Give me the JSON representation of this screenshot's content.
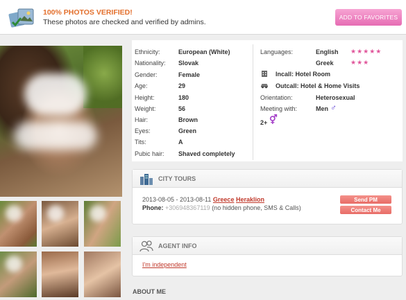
{
  "verified": {
    "title": "100% PHOTOS VERIFIED!",
    "subtitle": "These photos are checked and verified by admins.",
    "favorites_button": "ADD TO FAVORITES"
  },
  "attributes": [
    {
      "label": "Ethnicity:",
      "value": "European (White)"
    },
    {
      "label": "Nationality:",
      "value": "Slovak"
    },
    {
      "label": "Gender:",
      "value": "Female"
    },
    {
      "label": "Age:",
      "value": "29"
    },
    {
      "label": "Height:",
      "value": "180"
    },
    {
      "label": "Weight:",
      "value": "56"
    },
    {
      "label": "Hair:",
      "value": "Brown"
    },
    {
      "label": "Eyes:",
      "value": "Green"
    },
    {
      "label": "Tits:",
      "value": "A"
    },
    {
      "label": "Pubic hair:",
      "value": "Shaved completely"
    }
  ],
  "right": {
    "languages_label": "Languages:",
    "languages": [
      {
        "name": "English",
        "stars": "★★★★★"
      },
      {
        "name": "Greek",
        "stars": "★★★"
      }
    ],
    "incall": "Incall: Hotel Room",
    "outcall": "Outcall: Hotel & Home Visits",
    "orientation_label": "Orientation:",
    "orientation_value": "Heterosexual",
    "meeting_label": "Meeting with:",
    "meeting_value": "Men",
    "group": "2+"
  },
  "city_tours": {
    "title": "CITY TOURS",
    "dates": "2013-08-05 - 2013-08-11",
    "country": "Greece",
    "city": "Heraklion",
    "phone_label": "Phone:",
    "phone_value": "+306948367119",
    "phone_note": "(no hidden phone, SMS & Calls)",
    "send_pm": "Send PM",
    "contact_me": "Contact Me"
  },
  "agent_info": {
    "title": "AGENT INFO",
    "link": "I'm independent"
  },
  "about_me": "ABOUT ME",
  "colors": {
    "accent_orange": "#e36f2c",
    "favorites_pink": "#e66cb3",
    "star_pink": "#e0569b",
    "link_red": "#c0392b",
    "button_salmon": "#e86c66"
  }
}
